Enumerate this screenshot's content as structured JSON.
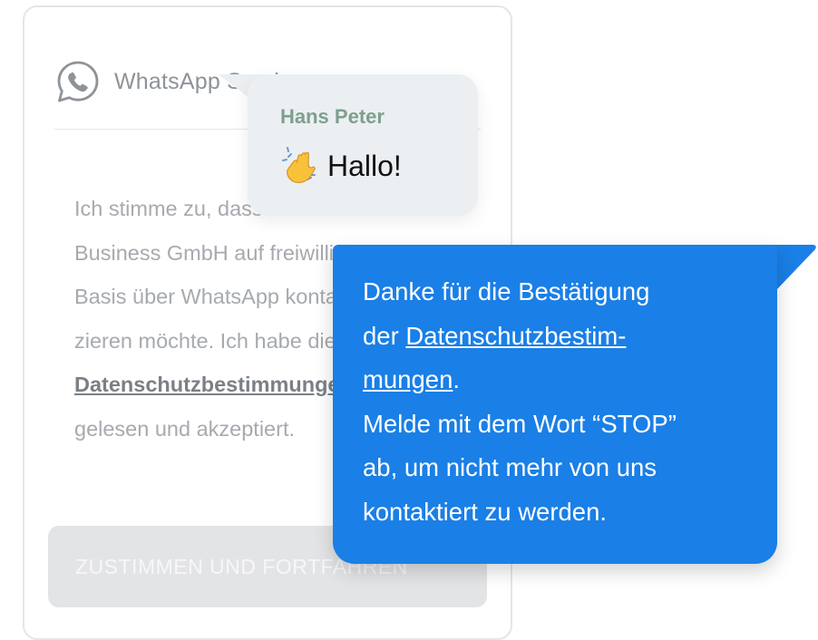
{
  "card": {
    "title": "WhatsApp Service",
    "consent_lines": [
      "Ich stimme zu, dass mich die",
      "Business GmbH auf freiwilliger",
      "Basis über WhatsApp kontaktie-",
      "zieren möchte. Ich habe die",
      "Datenschutzbestimmungen",
      "gelesen und akzeptiert."
    ],
    "button_label": "ZUSTIMMEN UND FORTFAHREN"
  },
  "incoming": {
    "sender": "Hans Peter",
    "text": "Hallo!",
    "emoji_icon": "waving-hand-icon"
  },
  "outgoing": {
    "line1": "Danke für die Bestätigung",
    "line2_prefix": "der ",
    "link_part1": "Datenschutzbestim-",
    "link_part2": "mungen",
    "line3_suffix": ".",
    "line4": "Melde mit dem Wort “STOP”",
    "line5": "ab, um nicht mehr von uns",
    "line6": "kontaktiert zu werden."
  },
  "colors": {
    "outgoing_bubble": "#1a7fe6",
    "incoming_bubble": "#eceff2",
    "sender_name": "#7da08e",
    "button_disabled": "#e3e4e6"
  }
}
